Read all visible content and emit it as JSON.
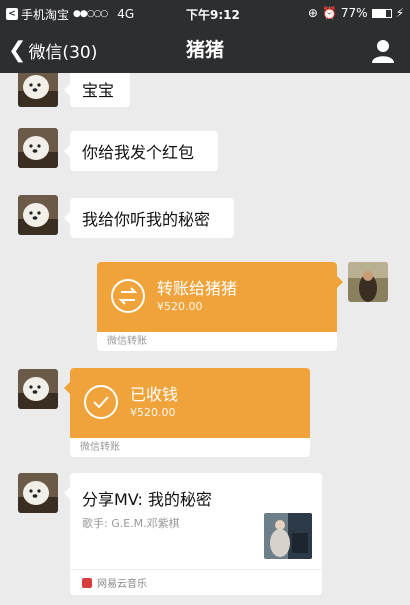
{
  "status": {
    "app_name": "手机淘宝",
    "signal": "●●○○○",
    "network": "4G",
    "time": "下午9:12",
    "battery": "77%",
    "battery_level": 0.77
  },
  "nav": {
    "back_label": "微信(30)",
    "title": "猪猪"
  },
  "messages": {
    "m1": "宝宝",
    "m2": "你给我发个红包",
    "m3": "我给你听我的秘密"
  },
  "transfer_sent": {
    "title": "转账给猪猪",
    "amount": "¥520.00",
    "footer": "微信转账"
  },
  "transfer_received": {
    "title": "已收钱",
    "amount": "¥520.00",
    "footer": "微信转账"
  },
  "share": {
    "title": "分享MV: 我的秘密",
    "subtitle": "歌手: G.E.M.邓紫棋",
    "source": "网易云音乐"
  },
  "colors": {
    "transfer": "#f0a33a",
    "header": "#2d2e30",
    "background": "#ebebeb"
  },
  "icons": {
    "back": "chevron-left-icon",
    "profile": "person-icon",
    "transfer_sent": "exchange-arrows-icon",
    "transfer_received": "checkmark-circle-icon",
    "music_source": "netease-music-icon"
  }
}
